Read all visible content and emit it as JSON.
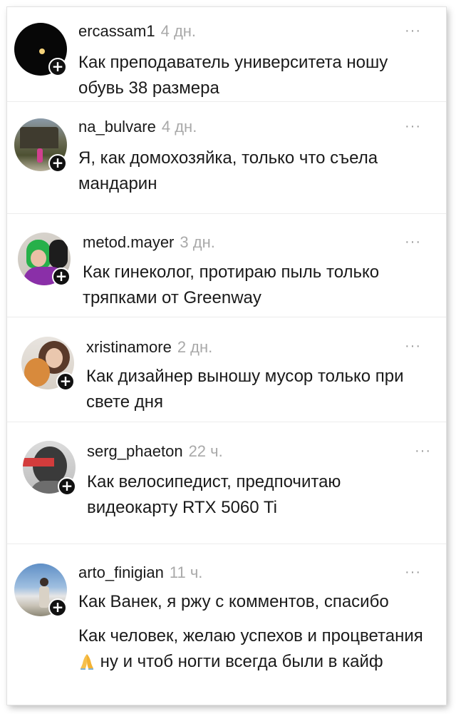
{
  "comments": [
    {
      "username": "ercassam1",
      "time": "4 дн.",
      "text": "Как преподаватель университета ношу обувь 38 размера"
    },
    {
      "username": "na_bulvare",
      "time": "4 дн.",
      "text": "Я, как домохозяйка, только что съела мандарин"
    },
    {
      "username": "metod.mayer",
      "time": "3 дн.",
      "text": "Как гинеколог, протираю пыль только тряпками от Greenway"
    },
    {
      "username": "xristinamore",
      "time": "2 дн.",
      "text": "Как дизайнер выношу мусор только при свете дня"
    },
    {
      "username": "serg_phaeton",
      "time": "22 ч.",
      "text": "Как велосипедист, предпочитаю видеокарту RTX 5060 Ti"
    },
    {
      "username": "arto_finigian",
      "time": "11 ч.",
      "text": "Как Ванек, я ржу с комментов, спасибо",
      "text2_a": "Как человек, желаю успехов и процветания",
      "text2_b": "ну и чтоб ногти всегда были в кайф"
    }
  ],
  "icons": {
    "follow": "plus-icon",
    "more": "more-dots-icon",
    "emoji": "folded-hands-emoji"
  },
  "colors": {
    "time": "#a9a9a9",
    "text": "#1a1a1a",
    "plus_bg": "#111111"
  }
}
